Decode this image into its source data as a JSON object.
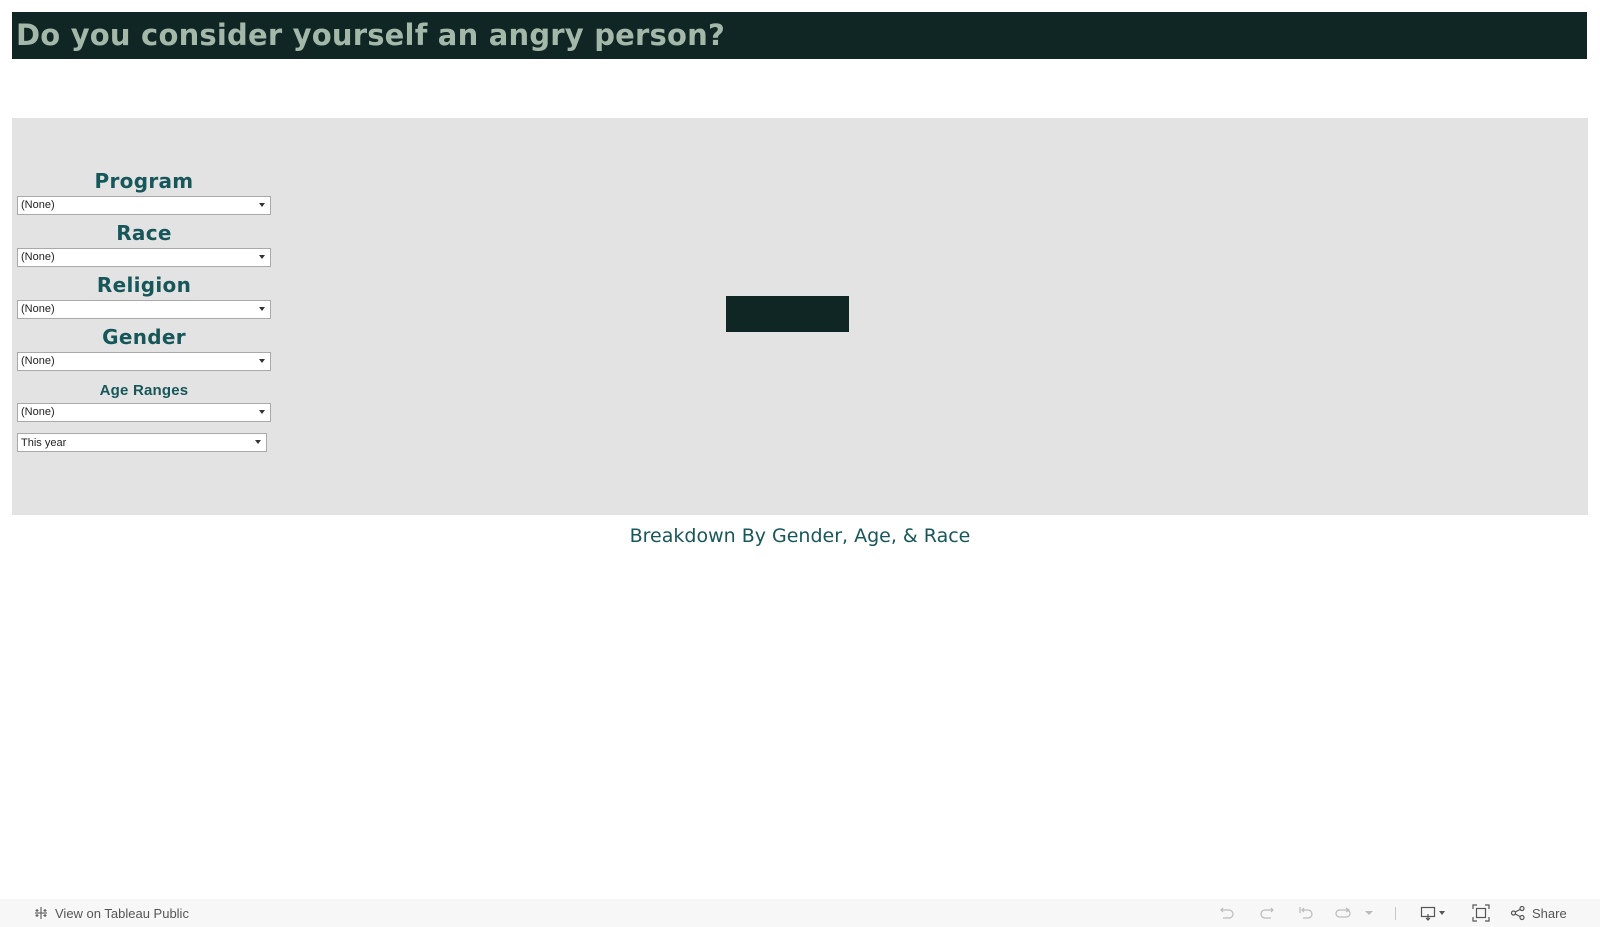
{
  "header": {
    "title": "Do you consider yourself an angry person?"
  },
  "filters": [
    {
      "label": "Program",
      "value": "(None)"
    },
    {
      "label": "Race",
      "value": "(None)"
    },
    {
      "label": "Religion",
      "value": "(None)"
    },
    {
      "label": "Gender",
      "value": "(None)"
    },
    {
      "label": "Age Ranges",
      "value": "(None)"
    }
  ],
  "date_filter": {
    "value": "This year"
  },
  "subtitle": "Breakdown By Gender, Age, & Race",
  "colors": {
    "header_bg": "#0f2624",
    "header_text": "#a4b8aa",
    "accent": "#17575a",
    "panel_bg": "#e3e3e3"
  },
  "footer": {
    "view_label": "View on Tableau Public",
    "share_label": "Share",
    "icons": [
      "tableau-logo-icon",
      "undo-icon",
      "redo-icon",
      "revert-icon",
      "refresh-icon",
      "dropdown-caret-icon",
      "download-icon",
      "fullscreen-icon",
      "share-icon"
    ]
  }
}
